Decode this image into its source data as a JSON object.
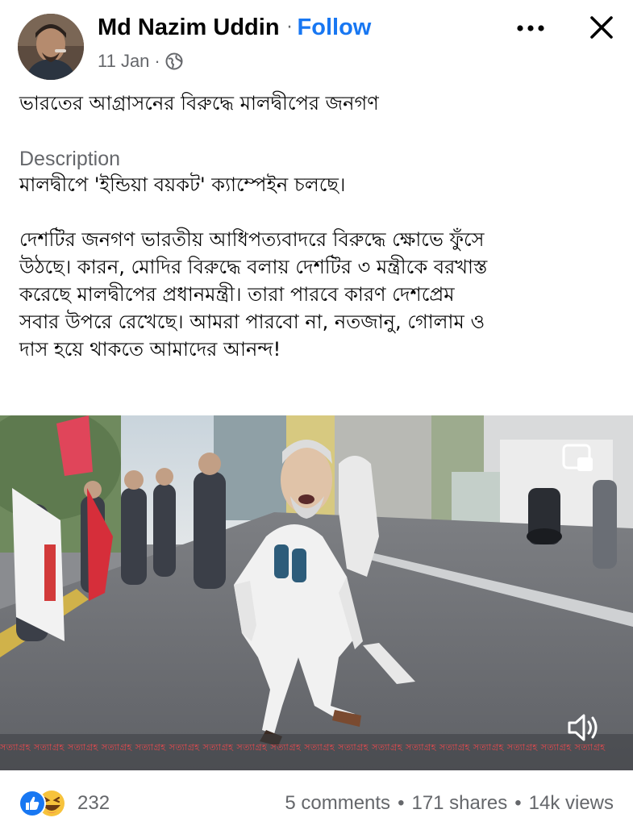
{
  "post": {
    "author": "Md Nazim Uddin",
    "separator": "·",
    "follow_label": "Follow",
    "date": "11 Jan",
    "meta_separator": "·",
    "privacy_icon": "globe-icon",
    "headline": "ভারতের আগ্রাসনের বিরুদ্ধে মালদ্বীপের জনগণ",
    "description_label": "Description",
    "description_first": "মালদ্বীপে 'ইন্ডিয়া বয়কট' ক্যাম্পেইন চলছে।",
    "description_body_lines": [
      "দেশটির জনগণ ভারতীয় আধিপত্যবাদরে বিরুদ্ধে ক্ষোভে ফুঁসে",
      "উঠছে। কারন, মোদির বিরুদ্ধে বলায় দেশটির ৩ মন্ত্রীকে বরখাস্ত",
      "করেছে মালদ্বীপের প্রধানমন্ত্রী। তারা পারবে কারণ দেশপ্রেম",
      "সবার উপরে রেখেছে। আমরা পারবো না, নতজানু, গোলাম ও",
      "দাস হয়ে থাকতে আমাদের আনন্দ!"
    ]
  },
  "header_icons": {
    "more": "more-icon",
    "close": "close-icon"
  },
  "video": {
    "ticker_text": "সত্যাগ্রহ সত্যাগ্রহ সত্যাগ্রহ সত্যাগ্রহ সত্যাগ্রহ সত্যাগ্রহ সত্যাগ্রহ সত্যাগ্রহ সত্যাগ্রহ সত্যাগ্রহ সত্যাগ্রহ সত্যাগ্রহ সত্যাগ্রহ সত্যাগ্রহ সত্যাগ্রহ সত্যাগ্রহ সত্যাগ্রহ সত্যাগ্রহ",
    "pip_icon": "picture-in-picture-icon",
    "volume_icon": "volume-icon"
  },
  "footer": {
    "reactions": [
      "like-icon",
      "haha-icon"
    ],
    "reaction_count": "232",
    "comments": "5 comments",
    "shares": "171 shares",
    "views": "14k views",
    "separator": "•"
  },
  "colors": {
    "link_blue": "#1877f2",
    "secondary_text": "#65676b",
    "primary_text": "#050505",
    "ticker_red": "#e8494e"
  }
}
